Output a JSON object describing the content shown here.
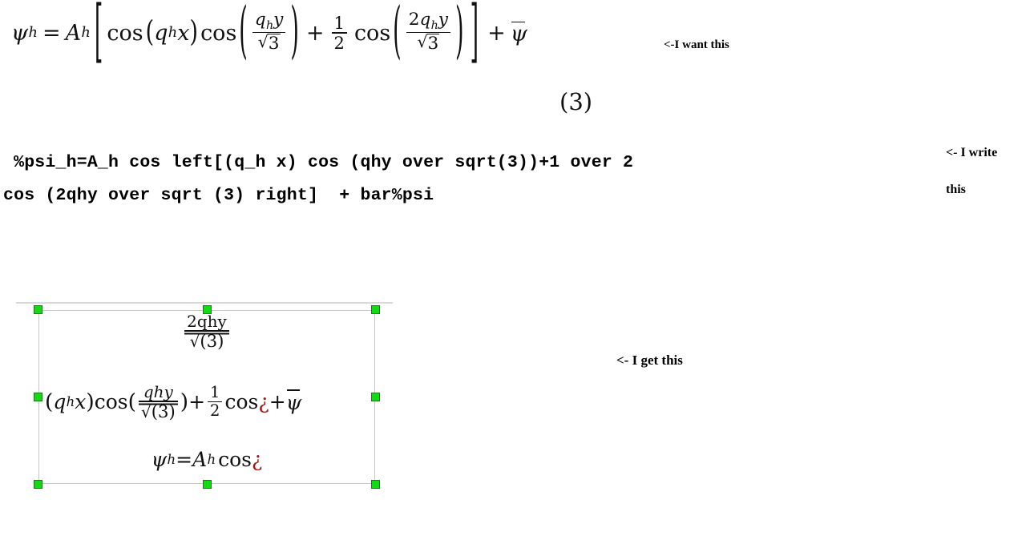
{
  "target_equation": {
    "label": "psi_h = A_h [ cos(q_h x) cos(q_h y / sqrt 3) + 1/2 cos(2 q_h y / sqrt 3) ] + psi-bar",
    "psi": "ψ",
    "sub_h": "h",
    "equals": "=",
    "A": "A",
    "bracket_open": "[",
    "bracket_close": "]",
    "cos": "cos",
    "paren_open": "(",
    "paren_close": ")",
    "q": "q",
    "x": "x",
    "y": "y",
    "plus": "+",
    "one": "1",
    "two": "2",
    "three": "3",
    "radical": "√",
    "two_q": "2",
    "psi_bar": "ψ"
  },
  "equation_number": "(3)",
  "source_markup": {
    "line1": " %psi_h=A_h cos left[(q_h x) cos (qhy over sqrt(3))+1 over 2",
    "line2": "cos (2qhy over sqrt (3) right]  + bar%psi"
  },
  "annotations": {
    "want": "<-I want this",
    "write_line1": "<- I write",
    "write_line2": "this",
    "get": "<- I get this"
  },
  "broken_render": {
    "top_fraction_numerator": "2qhy",
    "top_fraction_denominator_radical": "√",
    "top_fraction_denominator_body": "(3)",
    "main_paren_open": "(",
    "main_q": "q",
    "main_sub_h": "h",
    "main_x": "x",
    "main_paren_close": ")",
    "main_cos_1": "cos",
    "main_paren_open_2": "(",
    "mid_fraction_numerator": "qhy",
    "mid_fraction_denominator_radical": "√",
    "mid_fraction_denominator_body": "(3)",
    "main_paren_close_2": ")",
    "main_plus_1": "+",
    "half_numerator": "1",
    "half_denominator": "2",
    "main_cos_2": "cos",
    "error_glyph_1": "¿",
    "main_plus_2": "+",
    "psi_bar": "ψ",
    "bottom_psi": "ψ",
    "bottom_sub_h_1": "h",
    "bottom_equals": "=",
    "bottom_A": "A",
    "bottom_sub_h_2": "h",
    "bottom_cos": "cos",
    "error_glyph_2": "¿"
  },
  "colors": {
    "handle_fill": "#17d817",
    "handle_border": "#1a7a1a",
    "selection_frame": "#c8c8c8",
    "error_text": "#9e1b1b",
    "rule": "#d9d9d9"
  }
}
